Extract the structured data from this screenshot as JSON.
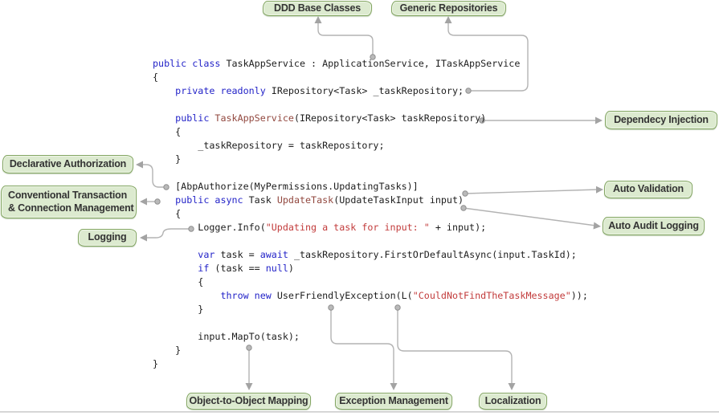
{
  "labels": {
    "ddd_base_classes": "DDD Base Classes",
    "generic_repositories": "Generic Repositories",
    "dependency_injection": "Dependecy Injection",
    "declarative_authorization": "Declarative Authorization",
    "conventional_transaction": "Conventional Transaction\n& Connection Management",
    "logging": "Logging",
    "auto_validation": "Auto Validation",
    "auto_audit_logging": "Auto Audit Logging",
    "object_to_object_mapping": "Object-to-Object Mapping",
    "exception_management": "Exception Management",
    "localization": "Localization"
  },
  "colors": {
    "label_fill": "#dceacf",
    "label_border": "#83a662",
    "label_text": "#333333",
    "keyword_blue": "#2323c8",
    "method_brown": "#92483f",
    "string_red": "#c23b3b",
    "code_text": "#1d1d1d",
    "connector_gray": "#b3b3b3"
  },
  "code": {
    "language": "csharp",
    "lines": [
      [
        [
          "kw",
          "public class "
        ],
        [
          "p",
          "TaskAppService : ApplicationService, ITaskAppService"
        ]
      ],
      [
        [
          "p",
          "{"
        ]
      ],
      [
        [
          "p",
          "    "
        ],
        [
          "kw",
          "private readonly "
        ],
        [
          "p",
          "IRepository<Task> _taskRepository;"
        ]
      ],
      [],
      [
        [
          "p",
          "    "
        ],
        [
          "kw",
          "public "
        ],
        [
          "m",
          "TaskAppService"
        ],
        [
          "p",
          "(IRepository<Task> taskRepository)"
        ]
      ],
      [
        [
          "p",
          "    {"
        ]
      ],
      [
        [
          "p",
          "        _taskRepository = taskRepository;"
        ]
      ],
      [
        [
          "p",
          "    }"
        ]
      ],
      [],
      [
        [
          "p",
          "    [AbpAuthorize(MyPermissions.UpdatingTasks)]"
        ]
      ],
      [
        [
          "p",
          "    "
        ],
        [
          "kw",
          "public async "
        ],
        [
          "p",
          "Task "
        ],
        [
          "m",
          "UpdateTask"
        ],
        [
          "p",
          "(UpdateTaskInput input)"
        ]
      ],
      [
        [
          "p",
          "    {"
        ]
      ],
      [
        [
          "p",
          "        Logger.Info("
        ],
        [
          "s",
          "\"Updating a task for input: \""
        ],
        [
          "p",
          " + input);"
        ]
      ],
      [],
      [
        [
          "p",
          "        "
        ],
        [
          "kw",
          "var"
        ],
        [
          "p",
          " task = "
        ],
        [
          "kw",
          "await"
        ],
        [
          "p",
          " _taskRepository.FirstOrDefaultAsync(input.TaskId);"
        ]
      ],
      [
        [
          "p",
          "        "
        ],
        [
          "kw",
          "if"
        ],
        [
          "p",
          " (task == "
        ],
        [
          "kw",
          "null"
        ],
        [
          "p",
          ")"
        ]
      ],
      [
        [
          "p",
          "        {"
        ]
      ],
      [
        [
          "p",
          "            "
        ],
        [
          "kw",
          "throw new"
        ],
        [
          "p",
          " UserFriendlyException(L("
        ],
        [
          "s",
          "\"CouldNotFindTheTaskMessage\""
        ],
        [
          "p",
          "));"
        ]
      ],
      [
        [
          "p",
          "        }"
        ]
      ],
      [],
      [
        [
          "p",
          "        input.MapTo(task);"
        ]
      ],
      [
        [
          "p",
          "    }"
        ]
      ],
      [
        [
          "p",
          "}"
        ]
      ]
    ]
  }
}
